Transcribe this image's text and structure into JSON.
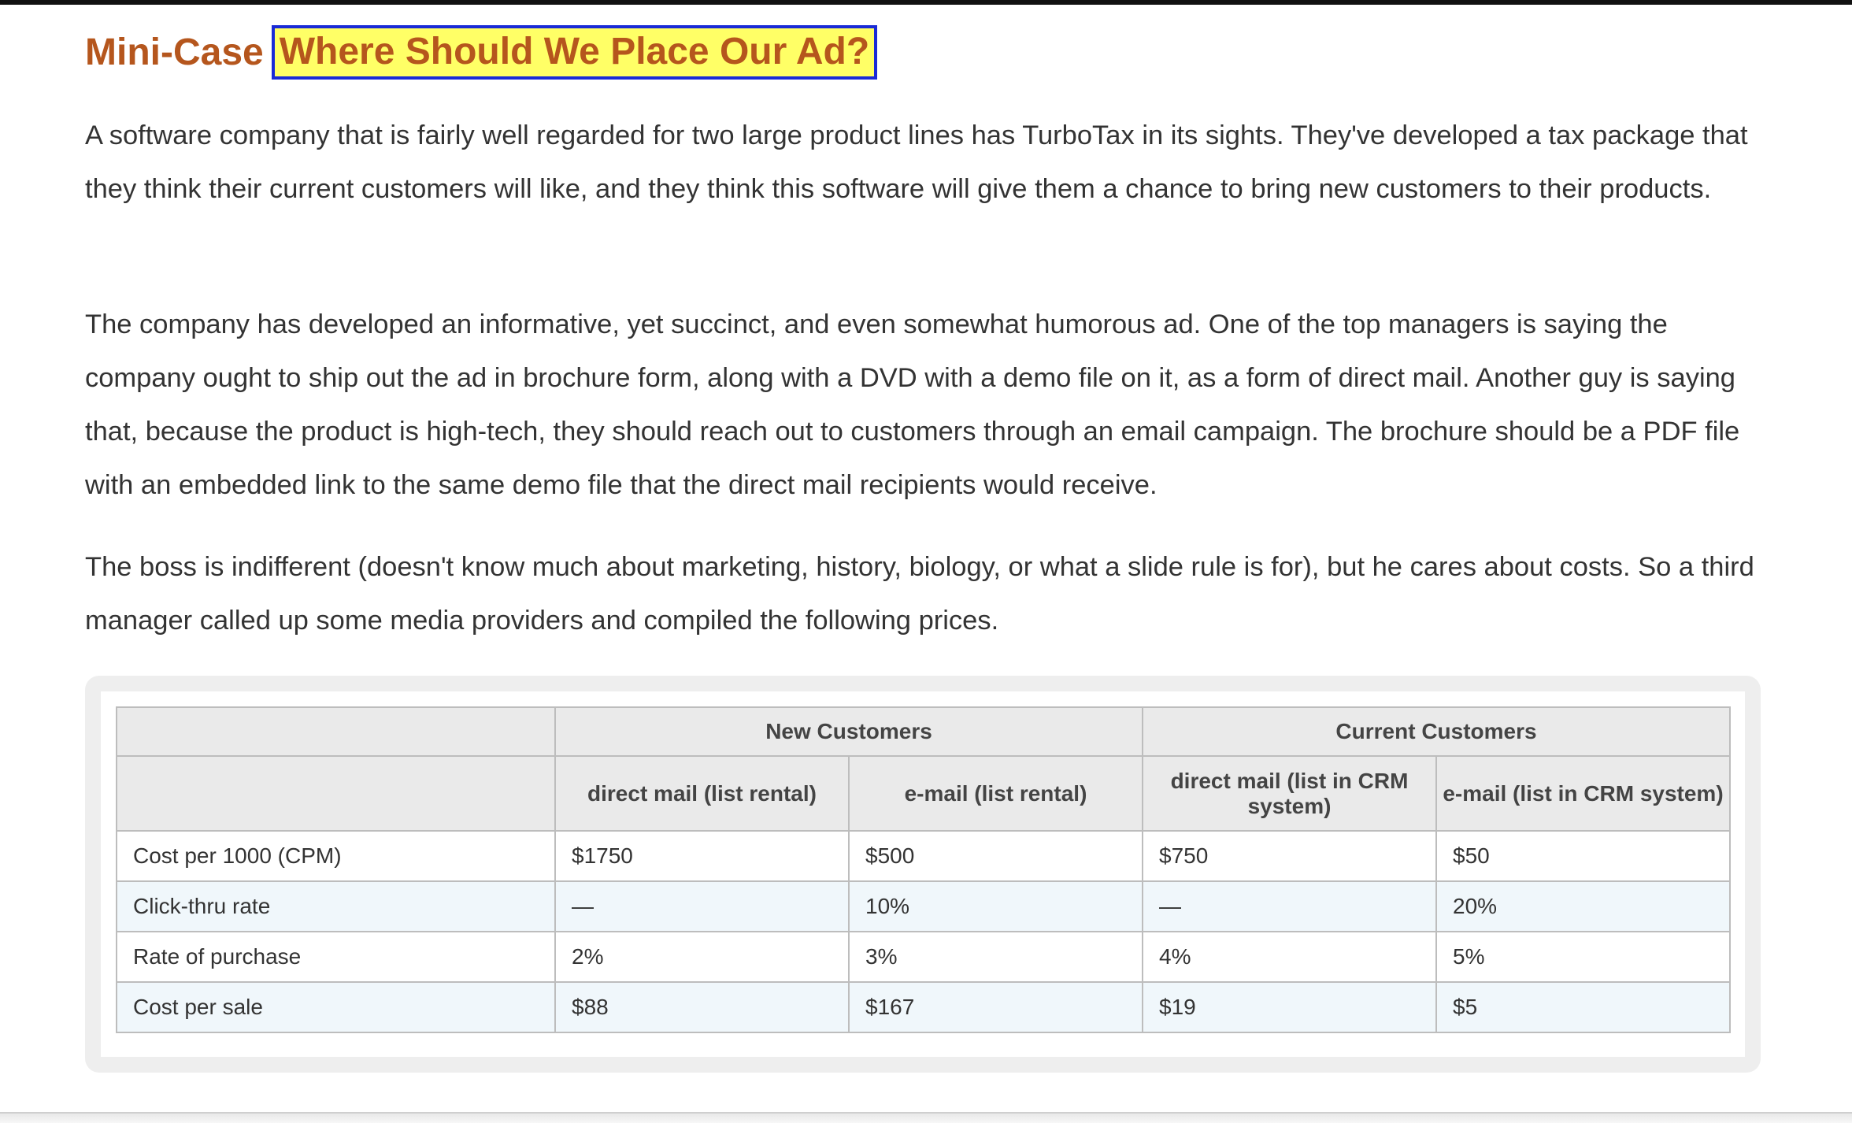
{
  "heading": {
    "prefix": "Mini-Case",
    "title": "Where Should We Place Our Ad?"
  },
  "paragraphs": [
    "A software company that is fairly well regarded for two large product lines has TurboTax in its sights. They've developed a tax package that they think their current customers will like, and they think this software will give them a chance to bring new customers to their products.",
    "The company has developed an informative, yet succinct, and even somewhat humorous ad. One of the top managers is saying the company ought to ship out the ad in brochure form, along with a DVD with a demo file on it, as a form of direct mail. Another guy is saying that, because the product is high-tech, they should reach out to customers through an email campaign. The brochure should be a PDF file with an embedded link to the same demo file that the direct mail recipients would receive.",
    "The boss is indifferent (doesn't know much about marketing, history, biology, or what a slide rule is for), but he cares about costs. So a third manager called up some media providers and compiled the following prices."
  ],
  "table": {
    "group_headers": [
      "New Customers",
      "Current Customers"
    ],
    "column_headers": [
      "direct mail (list rental)",
      "e-mail (list rental)",
      "direct mail (list in CRM system)",
      "e-mail (list in CRM system)"
    ],
    "rows": [
      {
        "label": "Cost per 1000 (CPM)",
        "cells": [
          "$1750",
          "$500",
          "$750",
          "$50"
        ]
      },
      {
        "label": "Click-thru rate",
        "cells": [
          "—",
          "10%",
          "—",
          "20%"
        ]
      },
      {
        "label": "Rate of purchase",
        "cells": [
          "2%",
          "3%",
          "4%",
          "5%"
        ]
      },
      {
        "label": "Cost per sale",
        "cells": [
          "$88",
          "$167",
          "$19",
          "$5"
        ]
      }
    ]
  }
}
